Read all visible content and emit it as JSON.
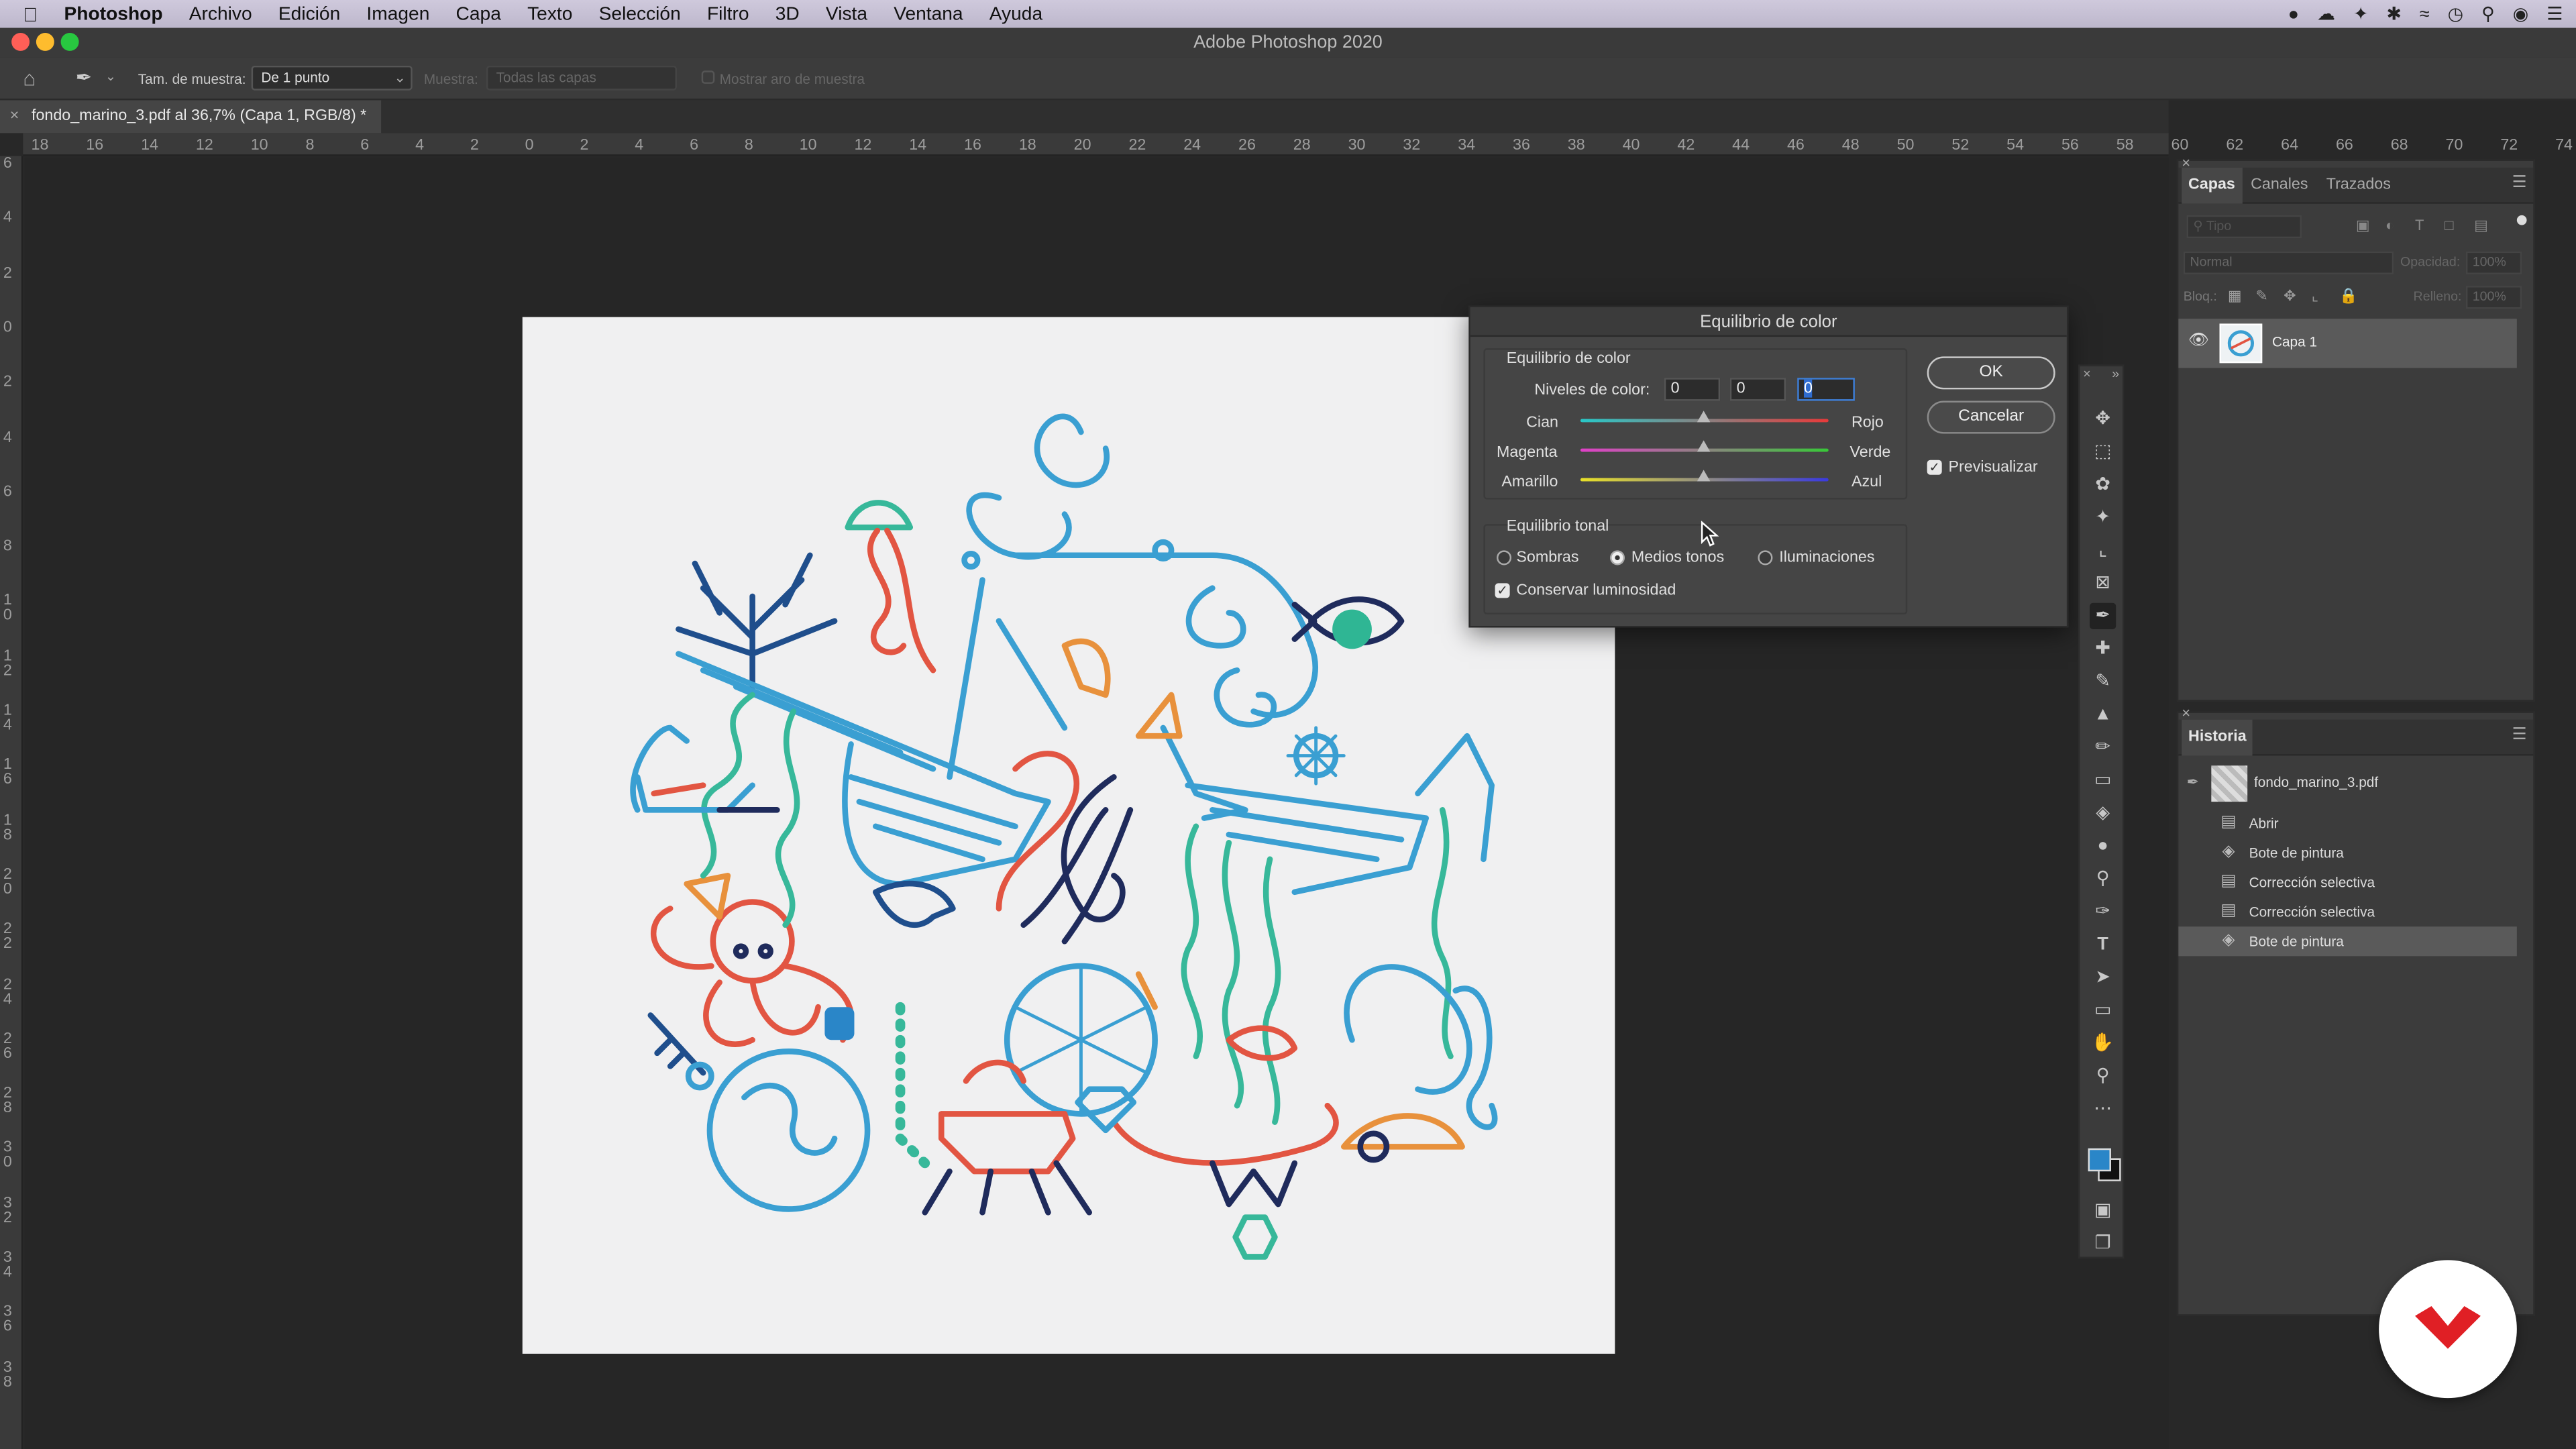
{
  "menubar": {
    "app": "Photoshop",
    "items": [
      "Archivo",
      "Edición",
      "Imagen",
      "Capa",
      "Texto",
      "Selección",
      "Filtro",
      "3D",
      "Vista",
      "Ventana",
      "Ayuda"
    ]
  },
  "window": {
    "title": "Adobe Photoshop 2020"
  },
  "options": {
    "sample_size_label": "Tam. de muestra:",
    "sample_size_value": "De 1 punto",
    "sample_label": "Muestra:",
    "sample_value": "Todas las capas",
    "show_ring_label": "Mostrar aro de muestra"
  },
  "document": {
    "tab_label": "fondo_marino_3.pdf al 36,7% (Capa 1, RGB/8) *"
  },
  "rulers": {
    "horizontal": [
      "18",
      "16",
      "14",
      "12",
      "10",
      "8",
      "6",
      "4",
      "2",
      "0",
      "2",
      "4",
      "6",
      "8",
      "10",
      "12",
      "14",
      "16",
      "18",
      "20",
      "22",
      "24",
      "26",
      "28",
      "30",
      "32",
      "34",
      "36",
      "38",
      "40",
      "42",
      "44",
      "46",
      "48",
      "50",
      "52",
      "54",
      "56",
      "58",
      "60",
      "62",
      "64",
      "66",
      "68",
      "70",
      "72",
      "74"
    ],
    "vertical": [
      "6",
      "4",
      "2",
      "0",
      "2",
      "4",
      "6",
      "8",
      "1 0",
      "1 2",
      "1 4",
      "1 6",
      "1 8",
      "2 0",
      "2 2",
      "2 4",
      "2 6",
      "2 8",
      "3 0",
      "3 2",
      "3 4",
      "3 6",
      "3 8"
    ]
  },
  "dialog": {
    "title": "Equilibrio de color",
    "group_color": "Equilibrio de color",
    "levels_label": "Niveles de color:",
    "levels": [
      "0",
      "0",
      "0"
    ],
    "sliders": [
      {
        "left": "Cian",
        "right": "Rojo",
        "value": 0,
        "colors": [
          "#28c8c8",
          "#e83a3a"
        ]
      },
      {
        "left": "Magenta",
        "right": "Verde",
        "value": 0,
        "colors": [
          "#e040c8",
          "#38c838"
        ]
      },
      {
        "left": "Amarillo",
        "right": "Azul",
        "value": 0,
        "colors": [
          "#e8e028",
          "#3a3ae0"
        ]
      }
    ],
    "group_tonal": "Equilibrio tonal",
    "tones": [
      "Sombras",
      "Medios tonos",
      "Iluminaciones"
    ],
    "selected_tone": "Medios tonos",
    "preserve_label": "Conservar luminosidad",
    "preserve_checked": true,
    "ok": "OK",
    "cancel": "Cancelar",
    "preview_label": "Previsualizar",
    "preview_checked": true
  },
  "layers_panel": {
    "tabs": [
      "Capas",
      "Canales",
      "Trazados"
    ],
    "active_tab": "Capas",
    "filter_placeholder": "Tipo",
    "blend_mode": "Normal",
    "opacity_label": "Opacidad:",
    "opacity_value": "100%",
    "lock_label": "Bloq.:",
    "fill_label": "Relleno:",
    "fill_value": "100%",
    "layers": [
      {
        "name": "Capa 1",
        "visible": true
      }
    ]
  },
  "history_panel": {
    "title": "Historia",
    "snapshot": "fondo_marino_3.pdf",
    "steps": [
      "Abrir",
      "Bote de pintura",
      "Corrección selectiva",
      "Corrección selectiva",
      "Bote de pintura"
    ],
    "active_step": 4
  },
  "colors": {
    "foreground": "#2a86c8",
    "background": "#111111",
    "brand": "#e01f25"
  }
}
